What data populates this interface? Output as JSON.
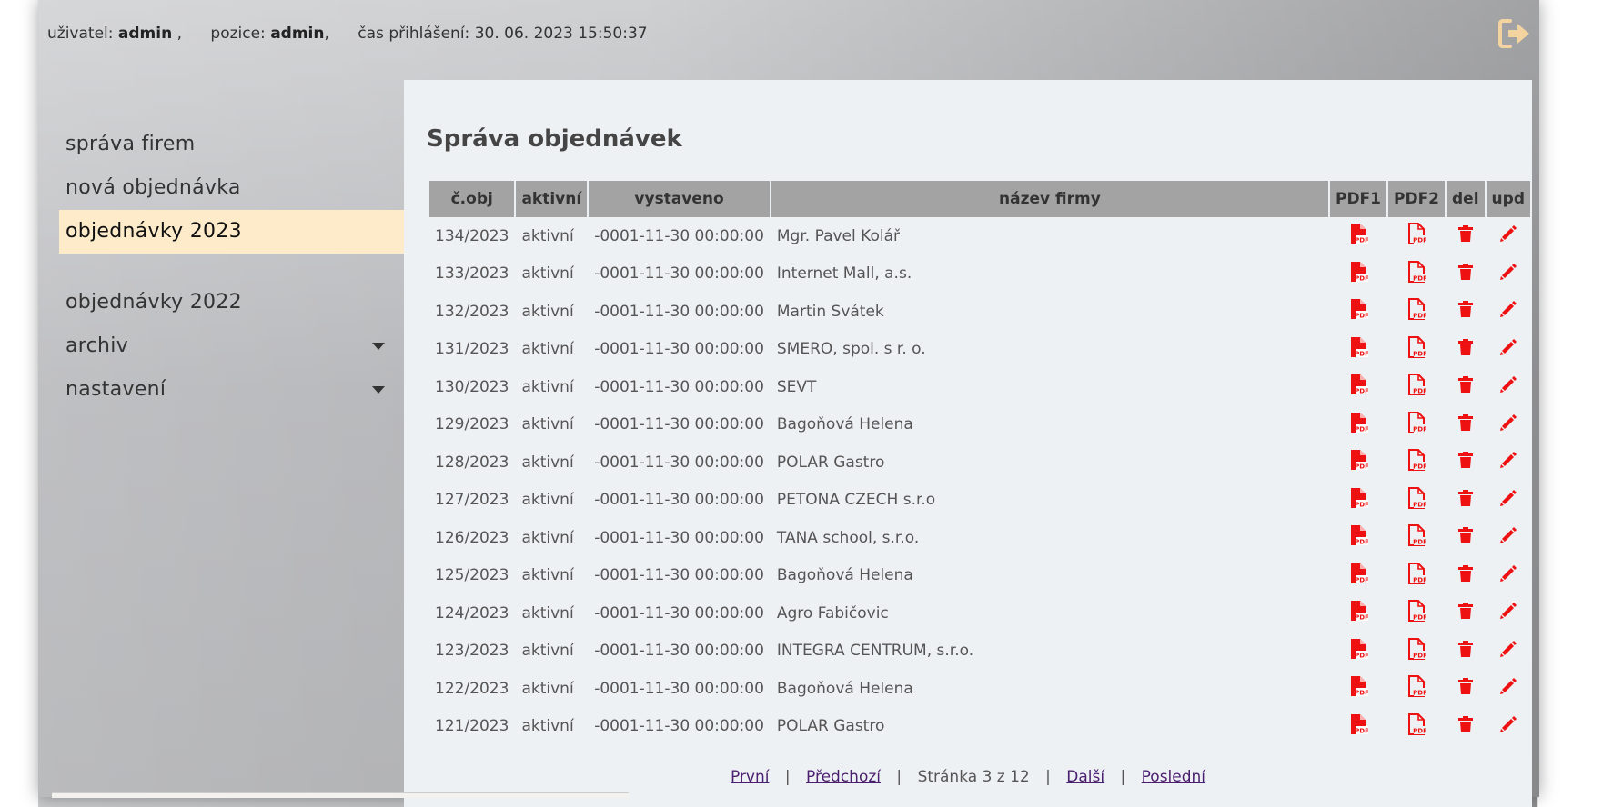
{
  "header": {
    "user_label": "uživatel:",
    "user_value": "admin",
    "user_sep": ",",
    "position_label": "pozice:",
    "position_value": "admin",
    "position_sep": ",",
    "login_time_label": "čas přihlášení:",
    "login_time_value": "30. 06. 2023 15:50:37",
    "logout_icon": "sign-out-icon"
  },
  "sidebar": {
    "items": [
      {
        "label": "správa firem"
      },
      {
        "label": "nová objednávka"
      },
      {
        "label": "objednávky 2023"
      },
      {
        "label": "objednávky 2022"
      },
      {
        "label": "archiv"
      },
      {
        "label": "nastavení"
      }
    ],
    "active_index": 2,
    "active_color": "#fdebc9"
  },
  "main": {
    "title": "Správa objednávek",
    "columns": [
      "č.obj",
      "aktivní",
      "vystaveno",
      "název firmy",
      "PDF1",
      "PDF2",
      "del",
      "upd"
    ],
    "icon_color": "#ee1111",
    "icons": {
      "pdf1": "pdf-file-icon",
      "pdf2": "pdf-file-outline-icon",
      "del": "trash-icon",
      "upd": "pencil-icon"
    },
    "rows": [
      {
        "num": "134/2023",
        "active": "aktivní",
        "issued": "-0001-11-30 00:00:00",
        "company": "Mgr. Pavel Kolář"
      },
      {
        "num": "133/2023",
        "active": "aktivní",
        "issued": "-0001-11-30 00:00:00",
        "company": "Internet Mall, a.s."
      },
      {
        "num": "132/2023",
        "active": "aktivní",
        "issued": "-0001-11-30 00:00:00",
        "company": "Martin Svátek"
      },
      {
        "num": "131/2023",
        "active": "aktivní",
        "issued": "-0001-11-30 00:00:00",
        "company": "SMERO, spol. s r. o."
      },
      {
        "num": "130/2023",
        "active": "aktivní",
        "issued": "-0001-11-30 00:00:00",
        "company": "SEVT"
      },
      {
        "num": "129/2023",
        "active": "aktivní",
        "issued": "-0001-11-30 00:00:00",
        "company": "Bagoňová Helena"
      },
      {
        "num": "128/2023",
        "active": "aktivní",
        "issued": "-0001-11-30 00:00:00",
        "company": "POLAR Gastro"
      },
      {
        "num": "127/2023",
        "active": "aktivní",
        "issued": "-0001-11-30 00:00:00",
        "company": "PETONA CZECH s.r.o"
      },
      {
        "num": "126/2023",
        "active": "aktivní",
        "issued": "-0001-11-30 00:00:00",
        "company": "TANA school, s.r.o."
      },
      {
        "num": "125/2023",
        "active": "aktivní",
        "issued": "-0001-11-30 00:00:00",
        "company": "Bagoňová Helena"
      },
      {
        "num": "124/2023",
        "active": "aktivní",
        "issued": "-0001-11-30 00:00:00",
        "company": "Agro Fabičovic"
      },
      {
        "num": "123/2023",
        "active": "aktivní",
        "issued": "-0001-11-30 00:00:00",
        "company": "INTEGRA CENTRUM, s.r.o."
      },
      {
        "num": "122/2023",
        "active": "aktivní",
        "issued": "-0001-11-30 00:00:00",
        "company": "Bagoňová Helena"
      },
      {
        "num": "121/2023",
        "active": "aktivní",
        "issued": "-0001-11-30 00:00:00",
        "company": "POLAR Gastro"
      }
    ]
  },
  "pager": {
    "first": "První",
    "prev": "Předchozí",
    "status": "Stránka 3 z 12",
    "next": "Další",
    "last": "Poslední",
    "separator": "|"
  }
}
